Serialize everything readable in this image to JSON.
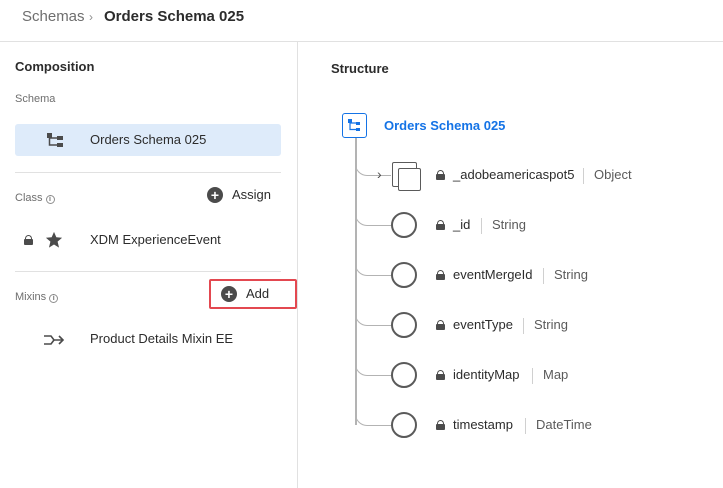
{
  "breadcrumb": {
    "root": "Schemas",
    "separator": "›",
    "current": "Orders Schema 025"
  },
  "composition": {
    "title": "Composition",
    "schema_label": "Schema",
    "schema_name": "Orders Schema 025",
    "class_label": "Class",
    "assign_label": "Assign",
    "class_name": "XDM ExperienceEvent",
    "mixins_label": "Mixins",
    "add_label": "Add",
    "mixin_name": "Product Details Mixin EE",
    "info_glyph": "i"
  },
  "structure": {
    "title": "Structure",
    "root_name": "Orders Schema 025",
    "fields": [
      {
        "name": "_adobeamericaspot5",
        "type": "Object"
      },
      {
        "name": "_id",
        "type": "String"
      },
      {
        "name": "eventMergeId",
        "type": "String"
      },
      {
        "name": "eventType",
        "type": "String"
      },
      {
        "name": "identityMap",
        "type": "Map"
      },
      {
        "name": "timestamp",
        "type": "DateTime"
      }
    ]
  },
  "colors": {
    "accent": "#1473e6",
    "selected_row": "#deebfa",
    "highlight_border": "#e34850"
  }
}
